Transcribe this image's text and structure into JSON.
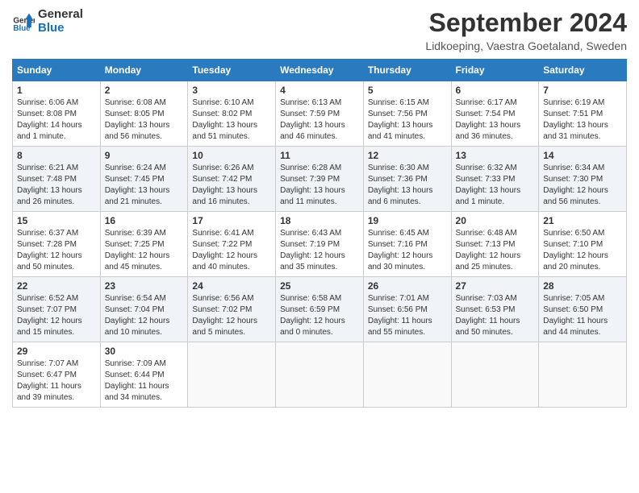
{
  "header": {
    "logo_line1": "General",
    "logo_line2": "Blue",
    "month": "September 2024",
    "location": "Lidkoeping, Vaestra Goetaland, Sweden"
  },
  "weekdays": [
    "Sunday",
    "Monday",
    "Tuesday",
    "Wednesday",
    "Thursday",
    "Friday",
    "Saturday"
  ],
  "weeks": [
    [
      {
        "day": "1",
        "sunrise": "6:06 AM",
        "sunset": "8:08 PM",
        "daylight": "14 hours and 1 minute."
      },
      {
        "day": "2",
        "sunrise": "6:08 AM",
        "sunset": "8:05 PM",
        "daylight": "13 hours and 56 minutes."
      },
      {
        "day": "3",
        "sunrise": "6:10 AM",
        "sunset": "8:02 PM",
        "daylight": "13 hours and 51 minutes."
      },
      {
        "day": "4",
        "sunrise": "6:13 AM",
        "sunset": "7:59 PM",
        "daylight": "13 hours and 46 minutes."
      },
      {
        "day": "5",
        "sunrise": "6:15 AM",
        "sunset": "7:56 PM",
        "daylight": "13 hours and 41 minutes."
      },
      {
        "day": "6",
        "sunrise": "6:17 AM",
        "sunset": "7:54 PM",
        "daylight": "13 hours and 36 minutes."
      },
      {
        "day": "7",
        "sunrise": "6:19 AM",
        "sunset": "7:51 PM",
        "daylight": "13 hours and 31 minutes."
      }
    ],
    [
      {
        "day": "8",
        "sunrise": "6:21 AM",
        "sunset": "7:48 PM",
        "daylight": "13 hours and 26 minutes."
      },
      {
        "day": "9",
        "sunrise": "6:24 AM",
        "sunset": "7:45 PM",
        "daylight": "13 hours and 21 minutes."
      },
      {
        "day": "10",
        "sunrise": "6:26 AM",
        "sunset": "7:42 PM",
        "daylight": "13 hours and 16 minutes."
      },
      {
        "day": "11",
        "sunrise": "6:28 AM",
        "sunset": "7:39 PM",
        "daylight": "13 hours and 11 minutes."
      },
      {
        "day": "12",
        "sunrise": "6:30 AM",
        "sunset": "7:36 PM",
        "daylight": "13 hours and 6 minutes."
      },
      {
        "day": "13",
        "sunrise": "6:32 AM",
        "sunset": "7:33 PM",
        "daylight": "13 hours and 1 minute."
      },
      {
        "day": "14",
        "sunrise": "6:34 AM",
        "sunset": "7:30 PM",
        "daylight": "12 hours and 56 minutes."
      }
    ],
    [
      {
        "day": "15",
        "sunrise": "6:37 AM",
        "sunset": "7:28 PM",
        "daylight": "12 hours and 50 minutes."
      },
      {
        "day": "16",
        "sunrise": "6:39 AM",
        "sunset": "7:25 PM",
        "daylight": "12 hours and 45 minutes."
      },
      {
        "day": "17",
        "sunrise": "6:41 AM",
        "sunset": "7:22 PM",
        "daylight": "12 hours and 40 minutes."
      },
      {
        "day": "18",
        "sunrise": "6:43 AM",
        "sunset": "7:19 PM",
        "daylight": "12 hours and 35 minutes."
      },
      {
        "day": "19",
        "sunrise": "6:45 AM",
        "sunset": "7:16 PM",
        "daylight": "12 hours and 30 minutes."
      },
      {
        "day": "20",
        "sunrise": "6:48 AM",
        "sunset": "7:13 PM",
        "daylight": "12 hours and 25 minutes."
      },
      {
        "day": "21",
        "sunrise": "6:50 AM",
        "sunset": "7:10 PM",
        "daylight": "12 hours and 20 minutes."
      }
    ],
    [
      {
        "day": "22",
        "sunrise": "6:52 AM",
        "sunset": "7:07 PM",
        "daylight": "12 hours and 15 minutes."
      },
      {
        "day": "23",
        "sunrise": "6:54 AM",
        "sunset": "7:04 PM",
        "daylight": "12 hours and 10 minutes."
      },
      {
        "day": "24",
        "sunrise": "6:56 AM",
        "sunset": "7:02 PM",
        "daylight": "12 hours and 5 minutes."
      },
      {
        "day": "25",
        "sunrise": "6:58 AM",
        "sunset": "6:59 PM",
        "daylight": "12 hours and 0 minutes."
      },
      {
        "day": "26",
        "sunrise": "7:01 AM",
        "sunset": "6:56 PM",
        "daylight": "11 hours and 55 minutes."
      },
      {
        "day": "27",
        "sunrise": "7:03 AM",
        "sunset": "6:53 PM",
        "daylight": "11 hours and 50 minutes."
      },
      {
        "day": "28",
        "sunrise": "7:05 AM",
        "sunset": "6:50 PM",
        "daylight": "11 hours and 44 minutes."
      }
    ],
    [
      {
        "day": "29",
        "sunrise": "7:07 AM",
        "sunset": "6:47 PM",
        "daylight": "11 hours and 39 minutes."
      },
      {
        "day": "30",
        "sunrise": "7:09 AM",
        "sunset": "6:44 PM",
        "daylight": "11 hours and 34 minutes."
      },
      null,
      null,
      null,
      null,
      null
    ]
  ]
}
